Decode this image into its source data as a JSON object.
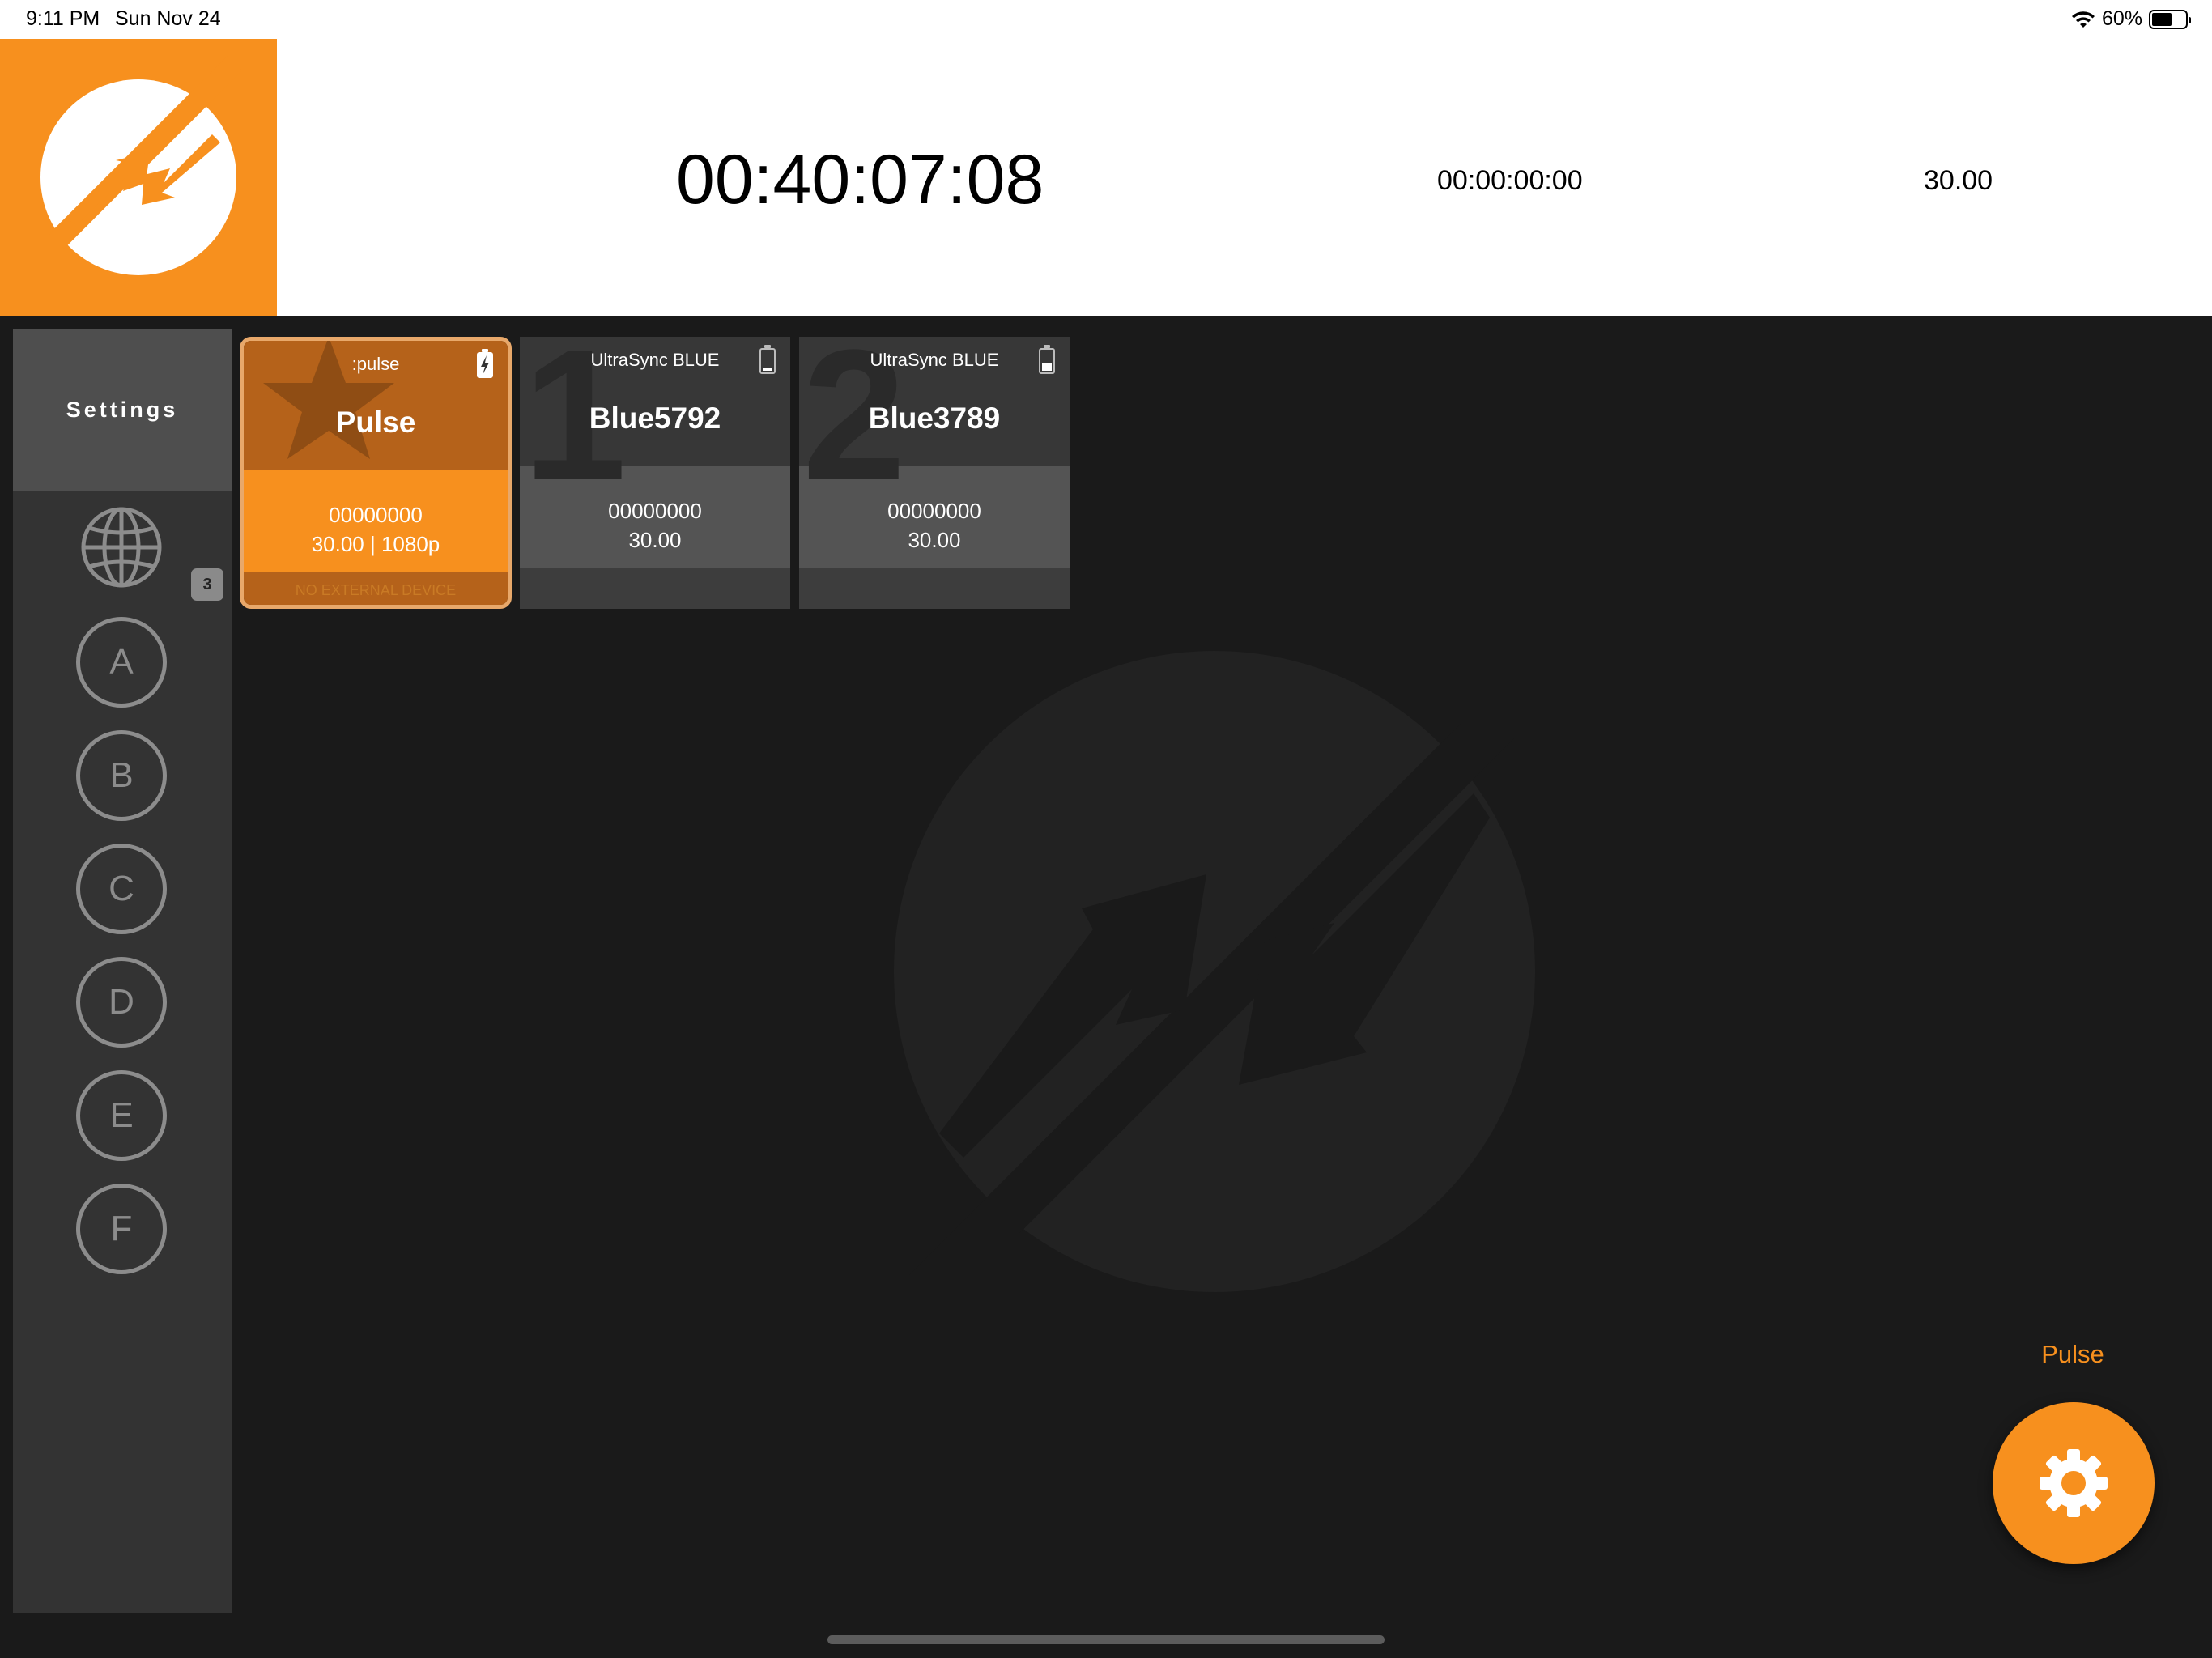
{
  "status_bar": {
    "time": "9:11 PM",
    "date": "Sun Nov 24",
    "battery": "60%"
  },
  "header": {
    "timecode": "00:40:07:08",
    "secondary_timecode": "00:00:00:00",
    "frame_rate": "30.00"
  },
  "sidebar": {
    "settings_label": "Settings",
    "device_count": "3",
    "groups": [
      "A",
      "B",
      "C",
      "D",
      "E",
      "F"
    ]
  },
  "devices": [
    {
      "type": ":pulse",
      "name": "Pulse",
      "timecode": "00000000",
      "rate": "30.00 | 1080p",
      "footer": "NO EXTERNAL DEVICE",
      "number": "",
      "battery_level": 100
    },
    {
      "type": "UltraSync BLUE",
      "name": "Blue5792",
      "timecode": "00000000",
      "rate": "30.00",
      "footer": "",
      "number": "1",
      "battery_level": 10
    },
    {
      "type": "UltraSync BLUE",
      "name": "Blue3789",
      "timecode": "00000000",
      "rate": "30.00",
      "footer": "",
      "number": "2",
      "battery_level": 30
    }
  ],
  "fab": {
    "label": "Pulse"
  },
  "colors": {
    "accent": "#f7901e",
    "background": "#1a1a1a",
    "sidebar": "#333333"
  }
}
